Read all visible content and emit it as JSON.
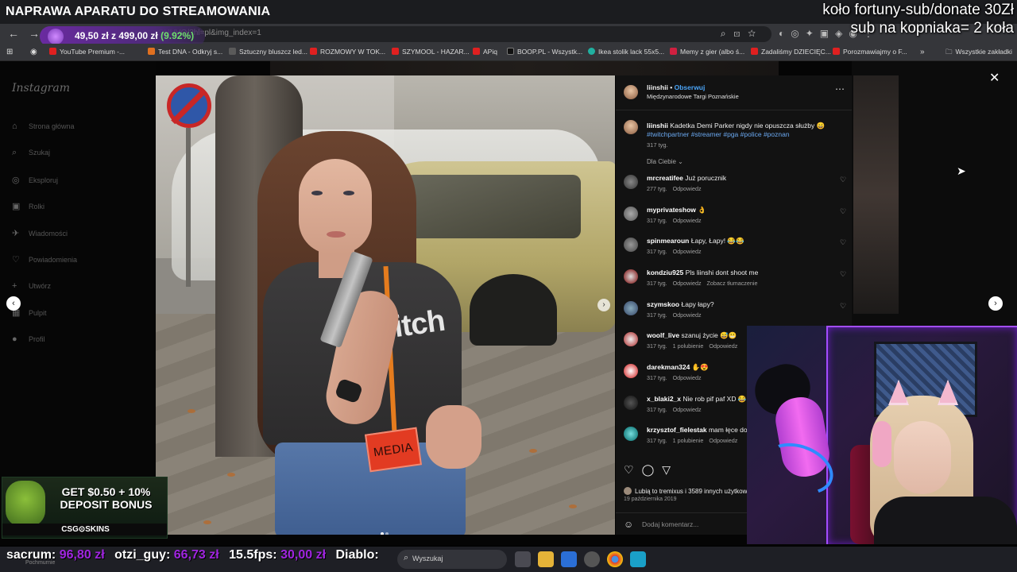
{
  "stream": {
    "title": "NAPRAWA APARATU DO STREAMOWANIA",
    "overlay_line1": "koło fortuny-sub/donate 30Zł",
    "overlay_line2": "sub na kopniaka= 2 koła"
  },
  "browser": {
    "url": "instagram.com/p/BMGUOHUVO/?hl=pl&img_index=1",
    "price_widget": {
      "text": "49,50 zł z 499,00 zł",
      "percent": "(9.92%)"
    },
    "bookmarks": [
      {
        "label": "YouTube Premium -...",
        "color": "#e02020"
      },
      {
        "label": "Test DNA - Odkryj s...",
        "color": "#e07020"
      },
      {
        "label": "Sztuczny bluszcz led...",
        "color": "#5a5a5a"
      },
      {
        "label": "ROZMOWY W TOK...",
        "color": "#e02020"
      },
      {
        "label": "SZYMOOL - HAZAR...",
        "color": "#e02020"
      },
      {
        "label": "APiq",
        "color": "#e02020"
      },
      {
        "label": "BOOP.PL - Wszystk...",
        "color": "#111111"
      },
      {
        "label": "Ikea stolik lack 55x5...",
        "color": "#20b0a0"
      },
      {
        "label": "Memy z gier (albo ś...",
        "color": "#d02040"
      },
      {
        "label": "Zadaliśmy DZIECIĘC...",
        "color": "#e02020"
      },
      {
        "label": "Porozmawiajmy o F...",
        "color": "#e02020"
      }
    ],
    "all_bookmarks": "Wszystkie zakładki"
  },
  "instagram": {
    "logo": "Instagram",
    "nav": [
      {
        "label": "Strona główna",
        "icon": "home-icon"
      },
      {
        "label": "Szukaj",
        "icon": "search-icon"
      },
      {
        "label": "Eksploruj",
        "icon": "compass-icon"
      },
      {
        "label": "Rolki",
        "icon": "reels-icon"
      },
      {
        "label": "Wiadomości",
        "icon": "messages-icon"
      },
      {
        "label": "Powiadomienia",
        "icon": "heart-icon"
      },
      {
        "label": "Utwórz",
        "icon": "plus-icon"
      },
      {
        "label": "Pulpit",
        "icon": "dashboard-icon"
      },
      {
        "label": "Profil",
        "icon": "profile-icon"
      }
    ],
    "photo": {
      "shirt_text": "itch",
      "badge_text": "MEDIA"
    },
    "post": {
      "username": "liinshii",
      "follow": "Obserwuj",
      "location": "Międzynarodowe Targi Poznańskie",
      "caption": "Kadetka Demi Parker nigdy nie opuszcza służby 😄",
      "hashtags": "#twitchpartner #streamer #pga #police #poznan",
      "caption_time": "317 tyg.",
      "for_you": "Dla Ciebie ⌄",
      "likes": "Lubią to tremixus i 3589 innych użytkowników",
      "date": "19 października 2019",
      "add_comment": "Dodaj komentarz..."
    },
    "comments": [
      {
        "user": "mrcreatifee",
        "text": "Już porucznik",
        "time": "277 tyg.",
        "likes": "",
        "reply": "Odpowiedz",
        "extra": ""
      },
      {
        "user": "myprivateshow",
        "text": "👌",
        "time": "317 tyg.",
        "likes": "",
        "reply": "Odpowiedz",
        "extra": ""
      },
      {
        "user": "spinmearoun",
        "text": "Łapy, Łapy! 😂😂",
        "time": "317 tyg.",
        "likes": "",
        "reply": "Odpowiedz",
        "extra": ""
      },
      {
        "user": "kondziu925",
        "text": "Pls liinshi dont shoot me",
        "time": "317 tyg.",
        "likes": "",
        "reply": "Odpowiedz",
        "extra": "Zobacz tłumaczenie"
      },
      {
        "user": "szymskoo",
        "text": "Łapy łapy?",
        "time": "317 tyg.",
        "likes": "",
        "reply": "Odpowiedz",
        "extra": ""
      },
      {
        "user": "woolf_live",
        "text": "szanuj życie 😅😬",
        "time": "317 tyg.",
        "likes": "1 polubienie",
        "reply": "Odpowiedz",
        "extra": ""
      },
      {
        "user": "darekman324",
        "text": "✋😍",
        "time": "317 tyg.",
        "likes": "",
        "reply": "Odpowiedz",
        "extra": ""
      },
      {
        "user": "x_blaki2_x",
        "text": "Nie rob pif paf XD 😂",
        "time": "317 tyg.",
        "likes": "",
        "reply": "Odpowiedz",
        "extra": ""
      },
      {
        "user": "krzysztof_fielestak",
        "text": "mam łęce do g",
        "time": "317 tyg.",
        "likes": "1 polubienie",
        "reply": "Odpowiedz",
        "extra": ""
      }
    ]
  },
  "ad": {
    "text": "GET $0.50 + 10% DEPOSIT BONUS",
    "brand": "CSG⊙SKINS"
  },
  "ticker": [
    {
      "name": "sacrum:",
      "amount": "96,80 zł"
    },
    {
      "name": "otzi_guy:",
      "amount": "66,73 zł"
    },
    {
      "name": "15.5fps:",
      "amount": "30,00 zł"
    },
    {
      "name": "Diablo:",
      "amount": ""
    }
  ],
  "taskbar": {
    "search_placeholder": "Wyszukaj",
    "weather": "Pochmurnie"
  }
}
